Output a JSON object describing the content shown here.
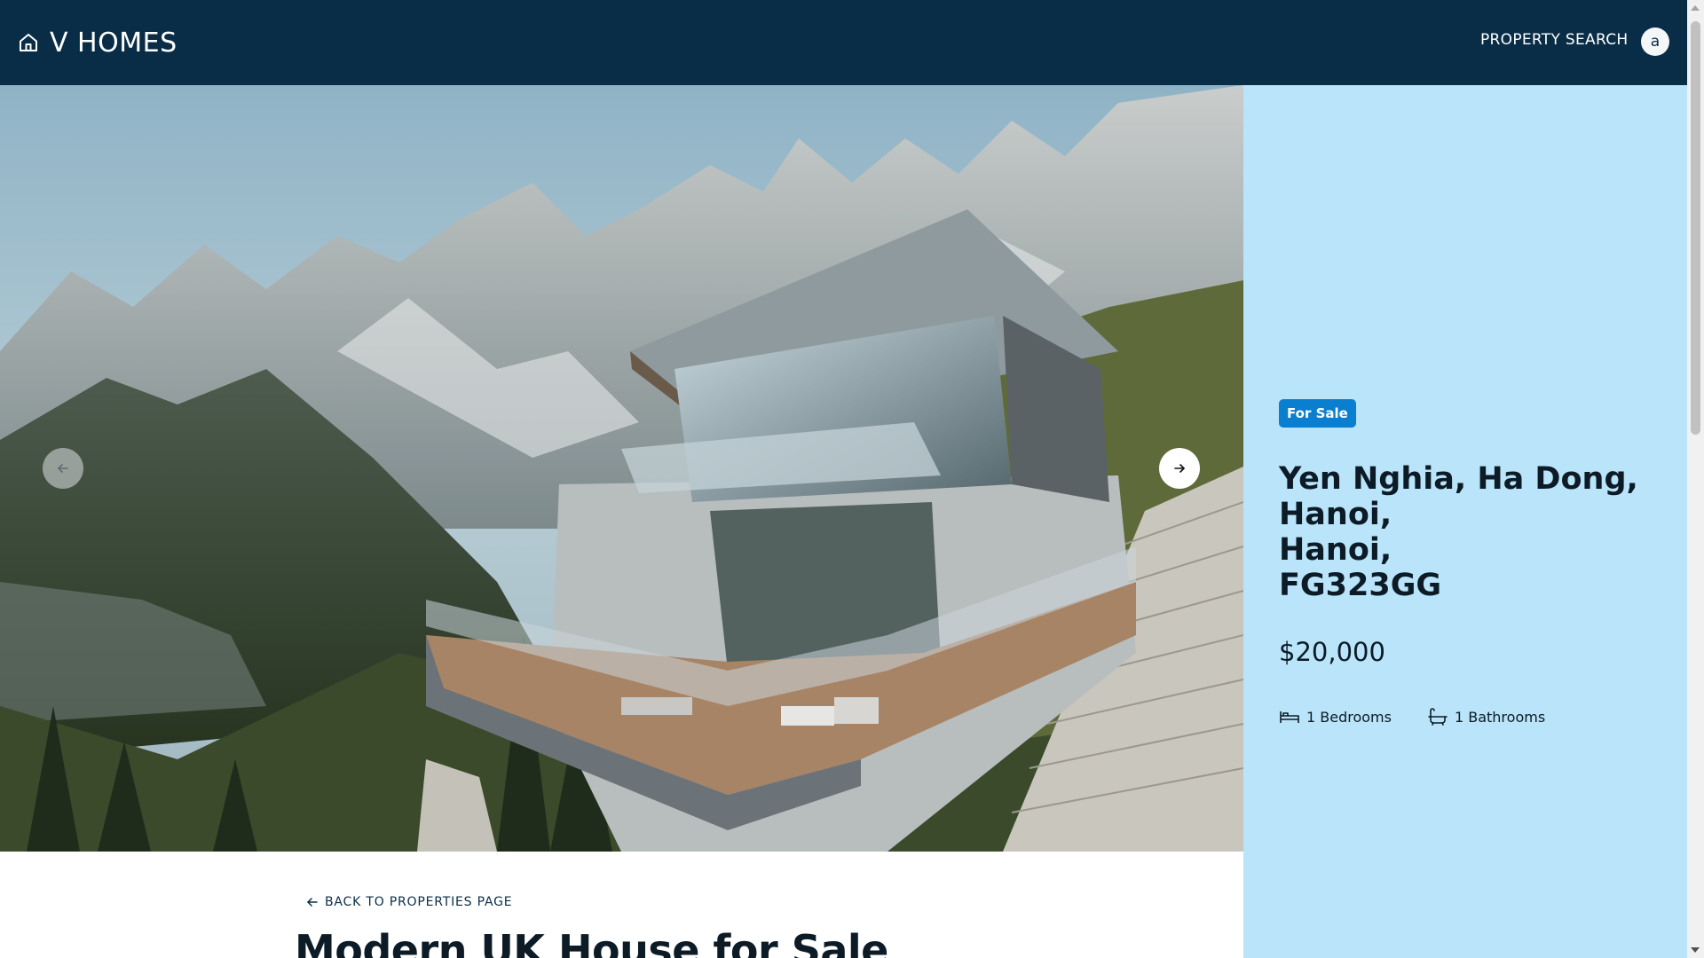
{
  "header": {
    "brand": "V HOMES",
    "brand_icon": "home-icon",
    "nav": [
      {
        "label": "PROPERTY SEARCH"
      }
    ],
    "avatar_initial": "a",
    "background": "#0a2d47"
  },
  "hero": {
    "image_description_icon": "house-photo",
    "prev_icon": "arrow-left-icon",
    "next_icon": "arrow-right-icon"
  },
  "details": {
    "status_badge": "For Sale",
    "address_lines": [
      "Yen Nghia, Ha Dong,",
      "Hanoi,",
      "Hanoi,",
      "FG323GG"
    ],
    "price": "$20,000",
    "features": [
      {
        "icon": "bed-icon",
        "label": "1 Bedrooms"
      },
      {
        "icon": "bath-icon",
        "label": "1 Bathrooms"
      }
    ],
    "background": "#b9e4f9",
    "badge_color": "#0b7fcf"
  },
  "content": {
    "back_label": "BACK TO PROPERTIES PAGE",
    "title": "Modern UK House for Sale"
  }
}
